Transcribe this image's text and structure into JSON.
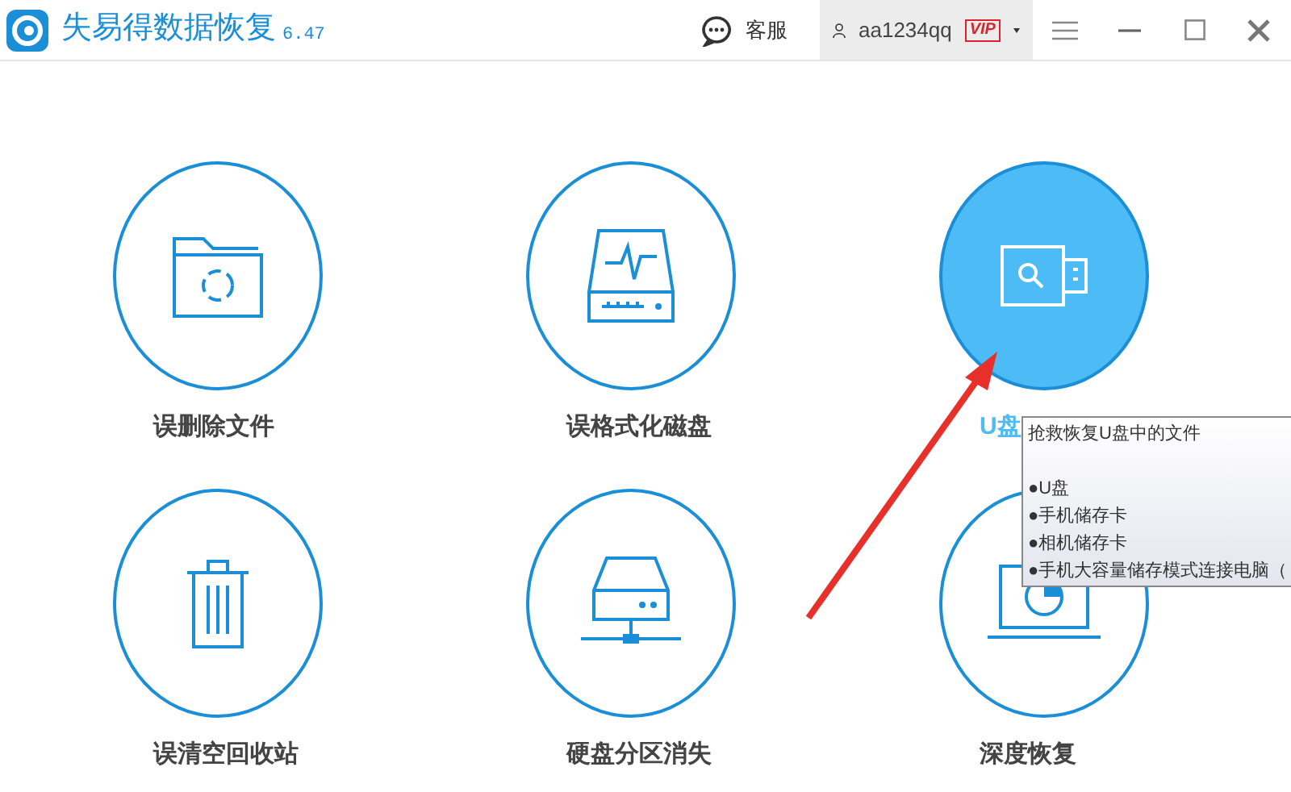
{
  "app": {
    "title": "失易得数据恢复",
    "version": "6.47"
  },
  "toolbar": {
    "support": "客服",
    "user": "aa1234qq",
    "badge": "VIP"
  },
  "modes": [
    {
      "kind": "folder",
      "label": "误删除文件",
      "selected": false
    },
    {
      "kind": "disk",
      "label": "误格式化磁盘",
      "selected": false
    },
    {
      "kind": "usb",
      "label": "U盘",
      "selected": true
    },
    {
      "kind": "trash",
      "label": "误清空回收站",
      "selected": false
    },
    {
      "kind": "server",
      "label": "硬盘分区消失",
      "selected": false
    },
    {
      "kind": "laptop",
      "label": "深度恢复",
      "selected": false
    }
  ],
  "tooltip": {
    "title": "抢救恢复U盘中的文件",
    "items": [
      "●U盘",
      "●手机储存卡",
      "●相机储存卡",
      "●手机大容量储存模式连接电脑（"
    ]
  }
}
